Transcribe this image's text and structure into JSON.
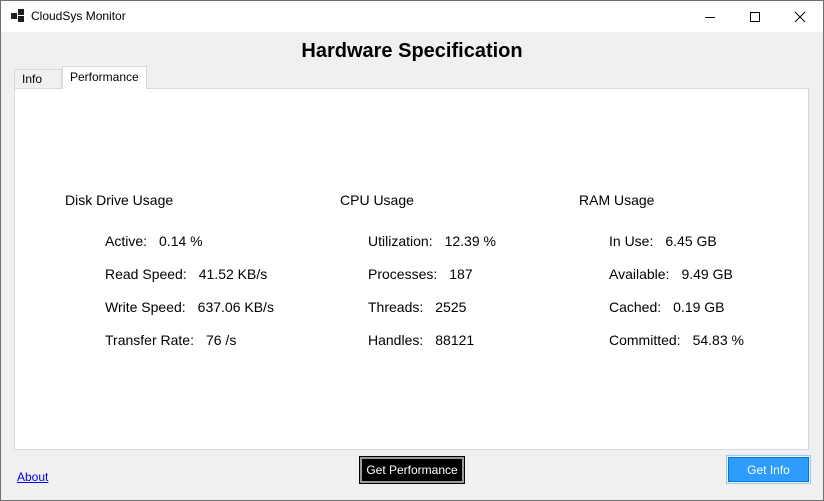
{
  "window": {
    "title": "CloudSys Monitor",
    "icons": {
      "app": "app-icon",
      "minimize": "minimize-icon",
      "maximize": "maximize-icon",
      "close": "close-icon"
    }
  },
  "header": {
    "title": "Hardware Specification"
  },
  "tabs": [
    {
      "label": "Info",
      "active": false
    },
    {
      "label": "Performance",
      "active": true
    }
  ],
  "performance": {
    "disk": {
      "title": "Disk Drive Usage",
      "rows": [
        {
          "label": "Active:",
          "value": "0.14 %"
        },
        {
          "label": "Read Speed:",
          "value": "41.52 KB/s"
        },
        {
          "label": "Write Speed:",
          "value": "637.06 KB/s"
        },
        {
          "label": "Transfer Rate:",
          "value": "76 /s"
        }
      ]
    },
    "cpu": {
      "title": "CPU Usage",
      "rows": [
        {
          "label": "Utilization:",
          "value": "12.39 %"
        },
        {
          "label": "Processes:",
          "value": "187"
        },
        {
          "label": "Threads:",
          "value": "2525"
        },
        {
          "label": "Handles:",
          "value": "88121"
        }
      ]
    },
    "ram": {
      "title": "RAM Usage",
      "rows": [
        {
          "label": "In Use:",
          "value": "6.45 GB"
        },
        {
          "label": "Available:",
          "value": "9.49 GB"
        },
        {
          "label": "Cached:",
          "value": "0.19 GB"
        },
        {
          "label": "Committed:",
          "value": "54.83 %"
        }
      ]
    }
  },
  "buttons": {
    "get_performance": "Get Performance",
    "get_info": "Get Info"
  },
  "links": {
    "about": "About"
  },
  "colors": {
    "accent_button": "#2e9bff",
    "dark_button": "#000000",
    "link": "#0000ee"
  }
}
